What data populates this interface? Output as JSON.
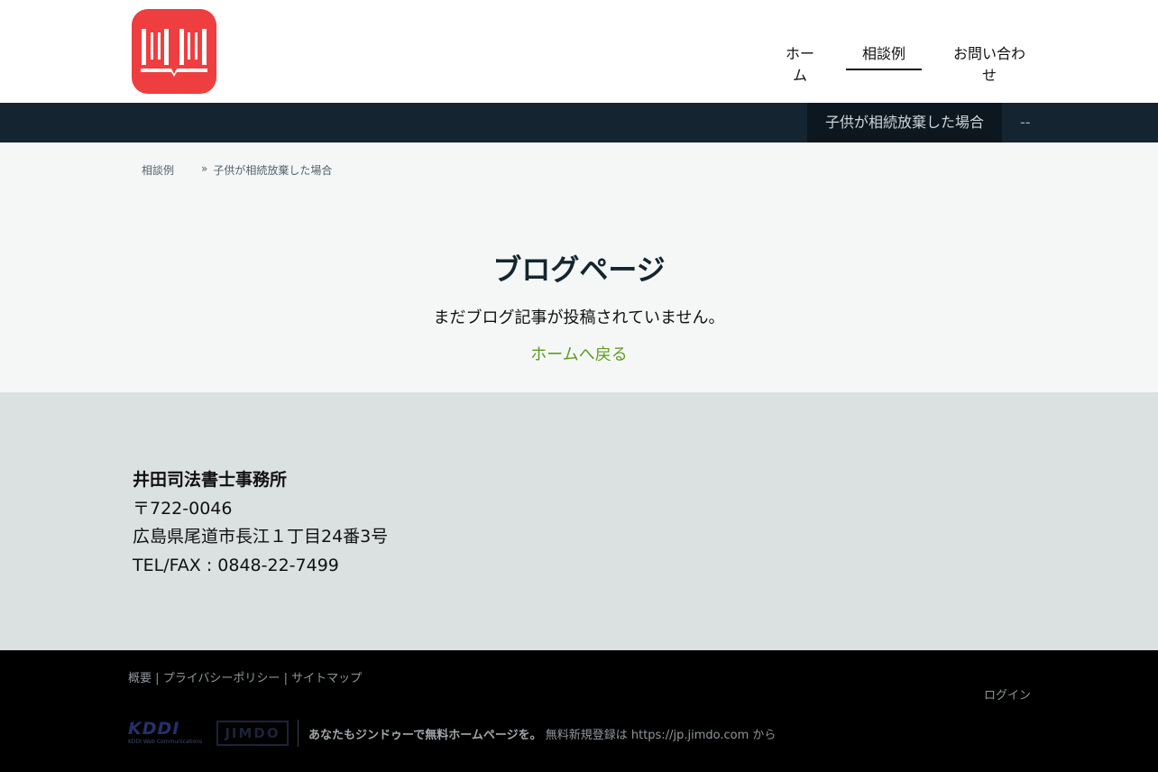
{
  "header": {
    "nav": [
      {
        "label": "ホーム"
      },
      {
        "label": "相談例"
      },
      {
        "label": "お問い合わせ"
      }
    ]
  },
  "subnav": {
    "items": [
      {
        "label": "子供が相続放棄した場合"
      },
      {
        "label": "--"
      }
    ]
  },
  "breadcrumb": {
    "items": [
      "相談例",
      "»",
      "子供が相続放棄した場合"
    ]
  },
  "main": {
    "title": "ブログページ",
    "empty_message": "まだブログ記事が投稿されていません。",
    "back_link": "ホームへ戻る"
  },
  "office": {
    "name": "井田司法書士事務所",
    "postal": "〒722-0046",
    "address": "広島県尾道市長江１丁目24番3号",
    "tel": "TEL/FAX : 0848-22-7499"
  },
  "footer": {
    "links": [
      "概要",
      "|",
      "プライバシーポリシー",
      "|",
      "サイトマップ"
    ],
    "login": "ログイン",
    "kddi_logo": "KDDI",
    "kddi_sub": "KDDI Web Communications",
    "jimdo_logo": "JIMDO",
    "promo_strong": "あなたもジンドゥーで無料ホームページを。",
    "promo_text": "無料新規登録は",
    "promo_url": "https://jp.jimdo.com",
    "promo_suffix": "から"
  },
  "colors": {
    "brand_red": "#ef3e3f",
    "subnav_bg": "#142531",
    "link_green": "#5e9c21"
  }
}
